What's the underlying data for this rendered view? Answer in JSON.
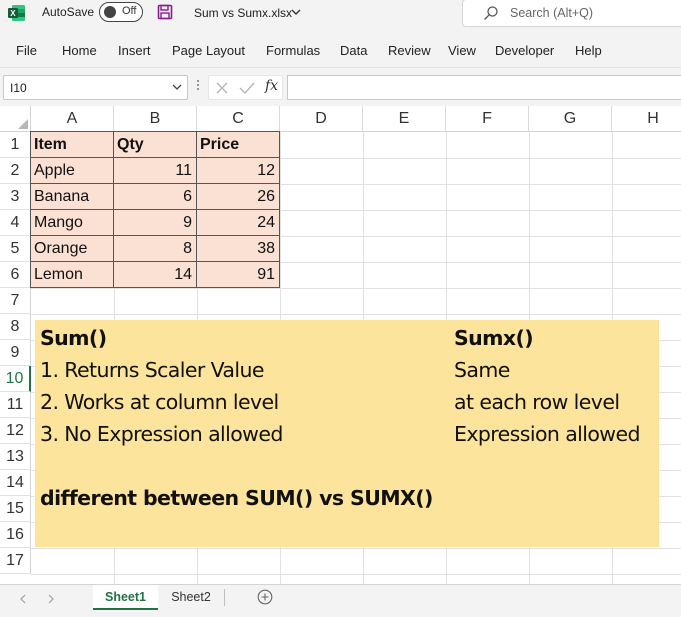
{
  "titlebar": {
    "autosave_label": "AutoSave",
    "autosave_state": "Off",
    "file_title": "Sum vs Sumx.xlsx",
    "search_placeholder": "Search (Alt+Q)"
  },
  "menu": [
    "File",
    "Home",
    "Insert",
    "Page Layout",
    "Formulas",
    "Data",
    "Review",
    "View",
    "Developer",
    "Help"
  ],
  "formula_bar": {
    "name_box": "I10",
    "fx": "fx",
    "formula": ""
  },
  "columns": [
    "A",
    "B",
    "C",
    "D",
    "E",
    "F",
    "G",
    "H"
  ],
  "rows": [
    "1",
    "2",
    "3",
    "4",
    "5",
    "6",
    "7",
    "8",
    "9",
    "10",
    "11",
    "12",
    "13",
    "14",
    "15",
    "16",
    "17"
  ],
  "active_row": "10",
  "table": {
    "headers": [
      "Item",
      "Qty",
      "Price"
    ],
    "rows": [
      [
        "Apple",
        "11",
        "12"
      ],
      [
        "Banana",
        "6",
        "26"
      ],
      [
        "Mango",
        "9",
        "24"
      ],
      [
        "Orange",
        "8",
        "38"
      ],
      [
        "Lemon",
        "14",
        "91"
      ]
    ]
  },
  "notes": {
    "sum_title": "Sum()",
    "sumx_title": "Sumx()",
    "sum_points": [
      "1. Returns Scaler Value",
      "2. Works at column level",
      "3. No Expression allowed"
    ],
    "sumx_points": [
      "Same",
      "at each row level",
      "Expression allowed"
    ],
    "footer": "different between SUM() vs SUMX()"
  },
  "sheets": {
    "tabs": [
      "Sheet1",
      "Sheet2"
    ],
    "active": "Sheet1"
  },
  "colors": {
    "excel_green": "#217346",
    "table_fill": "#fbe0d4",
    "notes_fill": "#fde49c"
  }
}
